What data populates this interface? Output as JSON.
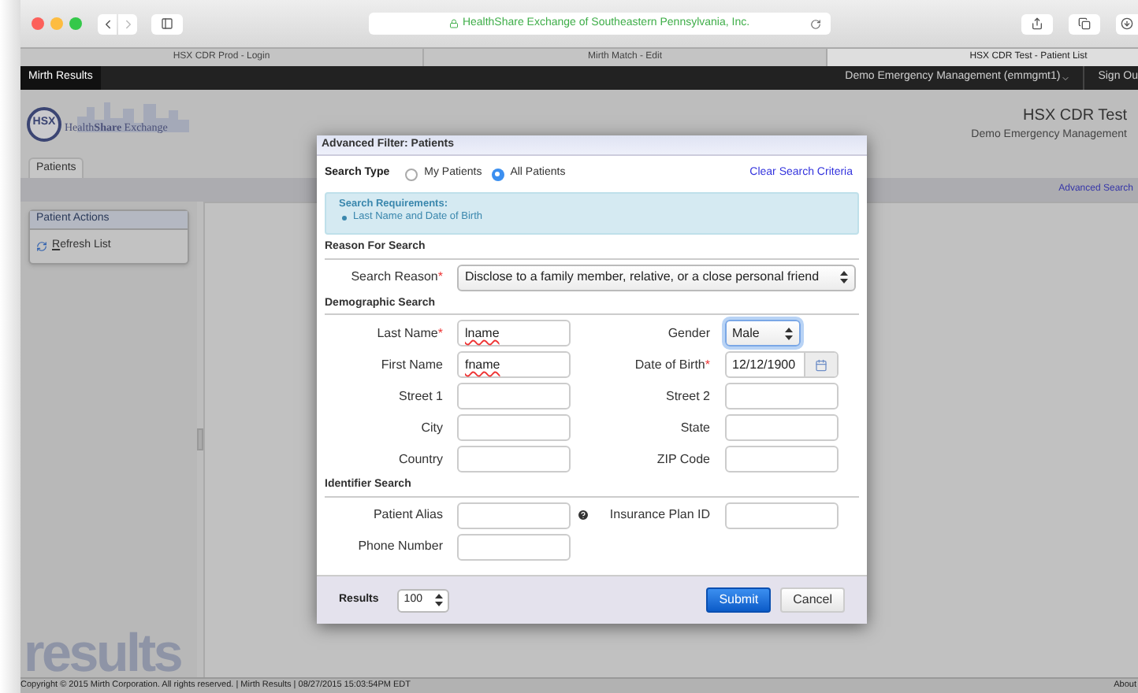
{
  "browser": {
    "address": "HealthShare Exchange of Southeastern Pennsylvania, Inc.",
    "tabs": [
      {
        "label": "HSX CDR Prod - Login",
        "selected": false
      },
      {
        "label": "Mirth Match - Edit",
        "selected": false
      },
      {
        "label": "HSX CDR Test - Patient List",
        "selected": true
      }
    ]
  },
  "app_bar": {
    "title": "Mirth Results",
    "user": "Demo Emergency Management (emmgmt1)",
    "sign_out": "Sign Ou"
  },
  "header": {
    "logo_mark": "HSX",
    "logo_name": "Health**Share** Exchange",
    "env_title": "HSX CDR Test",
    "env_subtitle": "Demo Emergency Management"
  },
  "page_tabs": [
    {
      "label": "Patients",
      "selected": true
    }
  ],
  "advanced_search": "Advanced Search",
  "sidebar": {
    "title": "Patient Actions",
    "items": [
      "Refresh List"
    ],
    "brand": "results"
  },
  "modal": {
    "title": "Advanced Filter: Patients",
    "required_mark": "*",
    "search_type": {
      "label": "Search Type",
      "options": [
        {
          "label": "My Patients",
          "selected": false
        },
        {
          "label": "All Patients",
          "selected": true
        }
      ]
    },
    "clear_link": "Clear Search Criteria",
    "requirements": {
      "title": "Search Requirements:",
      "items": [
        "Last Name and Date of Birth"
      ]
    },
    "sections": [
      {
        "title": "Reason For Search",
        "fields": [
          {
            "kind": "wide_select",
            "label": "Search Reason",
            "required": true,
            "value": "Disclose to a family member, relative, or a close personal friend"
          }
        ]
      },
      {
        "title": "Demographic Search",
        "fields": [
          {
            "kind": "text",
            "label": "Last Name",
            "required": true,
            "value": "lname",
            "misspelled": true
          },
          {
            "kind": "select",
            "label": "Gender",
            "required": false,
            "value": "Male",
            "focused": true
          },
          {
            "kind": "text",
            "label": "First Name",
            "required": false,
            "value": "fname",
            "misspelled": true
          },
          {
            "kind": "date",
            "label": "Date of Birth",
            "required": true,
            "value": "12/12/1900"
          },
          {
            "kind": "text",
            "label": "Street 1",
            "required": false
          },
          {
            "kind": "text",
            "label": "Street 2",
            "required": false
          },
          {
            "kind": "text",
            "label": "City",
            "required": false
          },
          {
            "kind": "text",
            "label": "State",
            "required": false
          },
          {
            "kind": "text",
            "label": "Country",
            "required": false
          },
          {
            "kind": "text",
            "label": "ZIP Code",
            "required": false
          }
        ]
      },
      {
        "title": "Identifier Search",
        "fields": [
          {
            "kind": "text",
            "label": "Patient Alias",
            "required": false,
            "help": true
          },
          {
            "kind": "text",
            "label": "Insurance Plan ID",
            "required": false
          },
          {
            "kind": "text",
            "label": "Phone Number",
            "required": false
          }
        ]
      }
    ],
    "results_label": "Results",
    "results_value": "100",
    "buttons": [
      {
        "label": "Submit",
        "kind": "primary"
      },
      {
        "label": "Cancel",
        "kind": "default"
      }
    ]
  },
  "status_bar": {
    "text": "Copyright © 2015 Mirth Corporation. All rights reserved. | Mirth Results | 08/27/2015 15:03:54PM EDT",
    "about": "About"
  }
}
